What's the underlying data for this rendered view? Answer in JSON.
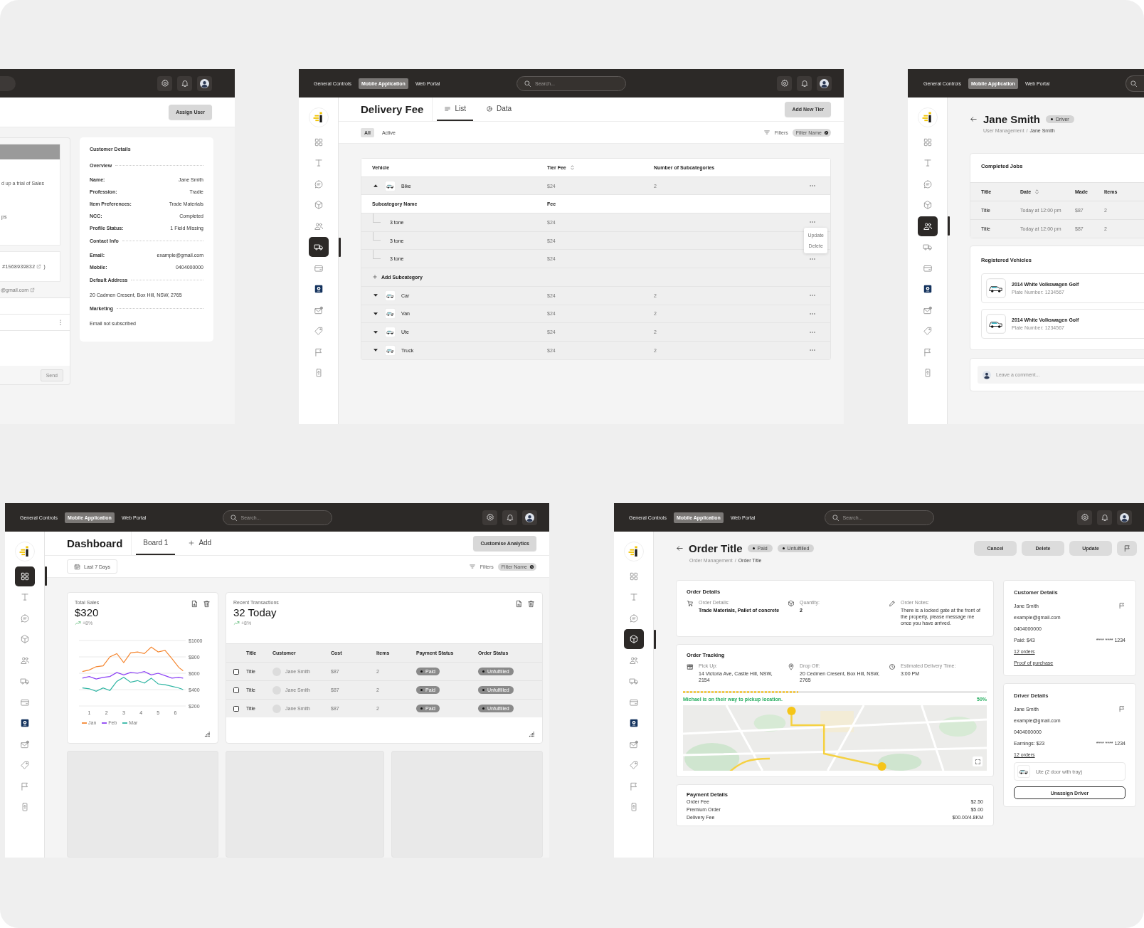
{
  "customer_screen": {
    "assign_button": "Assign User",
    "activity": {
      "line_1": "d up a trial of Sales",
      "line_2": "ps",
      "order_ref": "#1568939832",
      "ref_suffix": ")",
      "email": "@gmail.com",
      "send_button": {
        "label": "Send",
        "disabled": true
      }
    },
    "details": {
      "title": "Customer Details",
      "sections": [
        {
          "heading": "Overview",
          "rows": [
            {
              "label": "Name:",
              "value": "Jane Smith"
            },
            {
              "label": "Profession:",
              "value": "Tradie"
            },
            {
              "label": "Item Preferences:",
              "value": "Trade Materials"
            },
            {
              "label": "NCC:",
              "value": "Completed"
            },
            {
              "label": "Profile Status:",
              "value": "1 Field Missing"
            }
          ]
        },
        {
          "heading": "Contact Info",
          "rows": [
            {
              "label": "Email:",
              "value": "example@gmail.com"
            },
            {
              "label": "Mobile:",
              "value": "0404000000"
            }
          ]
        },
        {
          "heading": "Default Address",
          "text": "20 Cadmen Cresent, Box Hill, NSW, 2765"
        },
        {
          "heading": "Marketing",
          "text": "Email not subscribed"
        }
      ]
    }
  },
  "delivery_fee_screen": {
    "top_bar": {
      "tabs": [
        {
          "label": "General Controls",
          "selected": false
        },
        {
          "label": "Mobile Application",
          "selected": true
        },
        {
          "label": "Web Portal",
          "selected": false
        }
      ],
      "search": {
        "placeholder": "Search..."
      }
    },
    "sidebar": {
      "items": [
        {
          "selected": false
        },
        {
          "selected": false
        },
        {
          "selected": false
        },
        {
          "selected": false
        },
        {
          "selected": false
        },
        {
          "selected": true
        },
        {
          "selected": false
        },
        {
          "selected": false
        },
        {
          "selected": false
        },
        {
          "selected": false
        },
        {
          "selected": false
        },
        {
          "selected": false
        }
      ]
    },
    "title": "Delivery Fee",
    "view_tabs": [
      {
        "label": "List",
        "selected": true
      },
      {
        "label": "Data",
        "selected": false
      }
    ],
    "add_button": "Add New Tier",
    "filter_chips": [
      {
        "label": "All",
        "selected": true
      },
      {
        "label": "Active",
        "selected": false
      }
    ],
    "filters_label": "Filters",
    "filter_tag": "Filter Name",
    "table": {
      "columns": [
        "Vehicle",
        "Tier Fee",
        "Number of Subcategories"
      ],
      "sub_columns": [
        "Subcategory Name",
        "Fee"
      ],
      "add_subcategory": "Add Subcategory",
      "menu": [
        "Update",
        "Delete"
      ],
      "rows": [
        {
          "vehicle": "Bike",
          "fee": "$24",
          "count": "2",
          "expanded": true,
          "children": [
            {
              "name": "3 tone",
              "fee": "$24",
              "menu_open": false
            },
            {
              "name": "3 tone",
              "fee": "$24",
              "menu_open": true
            },
            {
              "name": "3 tone",
              "fee": "$24",
              "menu_open": false
            }
          ]
        },
        {
          "vehicle": "Car",
          "fee": "$24",
          "count": "2",
          "expanded": false
        },
        {
          "vehicle": "Van",
          "fee": "$24",
          "count": "2",
          "expanded": false
        },
        {
          "vehicle": "Ute",
          "fee": "$24",
          "count": "2",
          "expanded": false
        },
        {
          "vehicle": "Truck",
          "fee": "$24",
          "count": "2",
          "expanded": false
        }
      ]
    }
  },
  "driver_screen": {
    "top_bar": {
      "tabs": [
        {
          "label": "General Controls",
          "selected": false
        },
        {
          "label": "Mobile Application",
          "selected": true
        },
        {
          "label": "Web Portal",
          "selected": false
        }
      ]
    },
    "sidebar": {
      "items": [
        {
          "selected": false
        },
        {
          "selected": false
        },
        {
          "selected": false
        },
        {
          "selected": false
        },
        {
          "selected": true
        },
        {
          "selected": false
        },
        {
          "selected": false
        },
        {
          "selected": false
        },
        {
          "selected": false
        },
        {
          "selected": false
        },
        {
          "selected": false
        },
        {
          "selected": false
        }
      ]
    },
    "title": "Jane Smith",
    "badge": "Driver",
    "breadcrumb": [
      "User Management",
      "Jane Smith"
    ],
    "breadcrumb_separator": "/",
    "jobs": {
      "title": "Completed Jobs",
      "columns": [
        "Title",
        "Date",
        "Made",
        "Items"
      ],
      "rows": [
        [
          "Title",
          "Today at 12:00 pm",
          "$87",
          "2"
        ],
        [
          "Title",
          "Today at 12:00 pm",
          "$87",
          "2"
        ]
      ]
    },
    "vehicles": {
      "title": "Registered Vehicles",
      "items": [
        {
          "name": "2014 White Volkswagen Golf",
          "plate": "Plate Number: 1234567"
        },
        {
          "name": "2014 White Volkswagen Golf",
          "plate": "Plate Number: 1234567"
        }
      ]
    },
    "comment": {
      "placeholder": "Leave a comment..."
    }
  },
  "dashboard_screen": {
    "top_bar": {
      "tabs": [
        {
          "label": "General Controls",
          "selected": false
        },
        {
          "label": "Mobile Application",
          "selected": true
        },
        {
          "label": "Web Portal",
          "selected": false
        }
      ],
      "search": {
        "placeholder": "Search..."
      }
    },
    "sidebar": {
      "items": [
        {
          "selected": true
        },
        {
          "selected": false
        },
        {
          "selected": false
        },
        {
          "selected": false
        },
        {
          "selected": false
        },
        {
          "selected": false
        },
        {
          "selected": false
        },
        {
          "selected": false
        },
        {
          "selected": false
        },
        {
          "selected": false
        },
        {
          "selected": false
        },
        {
          "selected": false
        }
      ]
    },
    "title": "Dashboard",
    "board_tabs": [
      {
        "label": "Board 1",
        "selected": true
      }
    ],
    "add_tab": "Add",
    "customise_button": "Customise Analytics",
    "date_range": "Last 7 Days",
    "filters_label": "Filters",
    "filter_tag": "Filter Name",
    "sales_card": {
      "label": "Total Sales",
      "value": "$320",
      "change": "+8%",
      "chart_data": {
        "type": "line",
        "x": [
          0.6,
          1.0,
          1.4,
          1.8,
          2.2,
          2.6,
          3.0,
          3.4,
          3.8,
          4.2,
          4.6,
          5.0,
          5.4,
          5.8,
          6.2,
          6.45
        ],
        "xlim": [
          0.4,
          6.6
        ],
        "ylim": [
          200,
          1000
        ],
        "grid": true,
        "xticks": [
          1,
          2,
          3,
          4,
          5,
          6
        ],
        "yticks": [
          {
            "value": 200,
            "label": "$200"
          },
          {
            "value": 400,
            "label": "$400"
          },
          {
            "value": 600,
            "label": "$600"
          },
          {
            "value": 800,
            "label": "$800"
          },
          {
            "value": 1000,
            "label": "$1000"
          }
        ],
        "series": [
          {
            "name": "Jan",
            "color": "#f5862f",
            "values": [
              620,
              640,
              680,
              690,
              800,
              840,
              730,
              850,
              860,
              840,
              920,
              860,
              880,
              780,
              670,
              630
            ]
          },
          {
            "name": "Feb",
            "color": "#8b3ff5",
            "values": [
              540,
              560,
              530,
              550,
              560,
              610,
              580,
              610,
              600,
              620,
              580,
              600,
              570,
              540,
              550,
              540
            ]
          },
          {
            "name": "Mar",
            "color": "#2fb5a3",
            "values": [
              420,
              410,
              380,
              420,
              390,
              500,
              550,
              490,
              510,
              480,
              540,
              470,
              460,
              440,
              420,
              400
            ]
          }
        ]
      }
    },
    "transactions_card": {
      "label": "Recent Transactions",
      "value": "32 Today",
      "change": "+8%",
      "columns": [
        "Title",
        "Customer",
        "Cost",
        "Items",
        "Payment Status",
        "Order Status"
      ],
      "rows": [
        {
          "checked": false,
          "title": "Title",
          "customer": "Jane Smith",
          "cost": "$87",
          "items": "2",
          "payment": "Paid",
          "status": "Unfulfilled"
        },
        {
          "checked": false,
          "title": "Title",
          "customer": "Jane Smith",
          "cost": "$87",
          "items": "2",
          "payment": "Paid",
          "status": "Unfulfilled"
        },
        {
          "checked": false,
          "title": "Title",
          "customer": "Jane Smith",
          "cost": "$87",
          "items": "2",
          "payment": "Paid",
          "status": "Unfulfilled"
        }
      ]
    }
  },
  "order_screen": {
    "top_bar": {
      "tabs": [
        {
          "label": "General Controls",
          "selected": false
        },
        {
          "label": "Mobile Application",
          "selected": true
        },
        {
          "label": "Web Portal",
          "selected": false
        }
      ],
      "search": {
        "placeholder": "Search..."
      }
    },
    "sidebar": {
      "items": [
        {
          "selected": false
        },
        {
          "selected": false
        },
        {
          "selected": false
        },
        {
          "selected": true
        },
        {
          "selected": false
        },
        {
          "selected": false
        },
        {
          "selected": false
        },
        {
          "selected": false
        },
        {
          "selected": false
        },
        {
          "selected": false
        },
        {
          "selected": false
        },
        {
          "selected": false
        }
      ]
    },
    "title": "Order Title",
    "badges": [
      "Paid",
      "Unfulfilled"
    ],
    "breadcrumb": [
      "Order Management",
      "Order Title"
    ],
    "breadcrumb_separator": "/",
    "actions": [
      "Cancel",
      "Delete",
      "Update"
    ],
    "order_details": {
      "title": "Order Details",
      "items": [
        {
          "kind": "cart",
          "label": "Order Details:",
          "value": "Trade Materials, Pallet of concrete"
        },
        {
          "kind": "box",
          "label": "Quantity:",
          "value": "2"
        },
        {
          "kind": "note",
          "label": "Order Notes:",
          "value": "There is a locked gate at the front of the property, please message me once you have arrived."
        }
      ]
    },
    "tracking": {
      "title": "Order Tracking",
      "items": [
        {
          "kind": "store",
          "label": "Pick Up:",
          "value": "14 Victoria Ave, Castle Hill, NSW, 2154"
        },
        {
          "kind": "pin",
          "label": "Drop Off:",
          "value": "20 Cedmen Cresent, Box Hill, NSW, 2765"
        },
        {
          "kind": "clock",
          "label": "Estimated Delivery Time:",
          "value": "3:00 PM"
        }
      ],
      "progress": {
        "level": 0.38,
        "status": "Michael is on their way to pickup location.",
        "percent": "50%"
      }
    },
    "payment": {
      "title": "Payment Details",
      "rows": [
        {
          "label": "Order Fee",
          "value": "$2.50"
        },
        {
          "label": "Premium Order",
          "value": "$5.00"
        },
        {
          "label": "Delivery Fee",
          "value": "$00.00/4.8KM"
        }
      ]
    },
    "customer": {
      "title": "Customer Details",
      "name": "Jane Smith",
      "email": "example@gmail.com",
      "phone": "0404000000",
      "amount": "Paid: $43",
      "card": "**** **** 1234",
      "links": [
        "12 orders",
        "Proof of purchase"
      ]
    },
    "driver": {
      "title": "Driver Details",
      "name": "Jane Smith",
      "email": "example@gmail.com",
      "phone": "0404000000",
      "amount": "Earnings: $23",
      "card": "**** **** 1234",
      "links": [
        "12 orders"
      ],
      "vehicle": "Ute (2 door with tray)",
      "button": "Unassign Driver"
    }
  }
}
